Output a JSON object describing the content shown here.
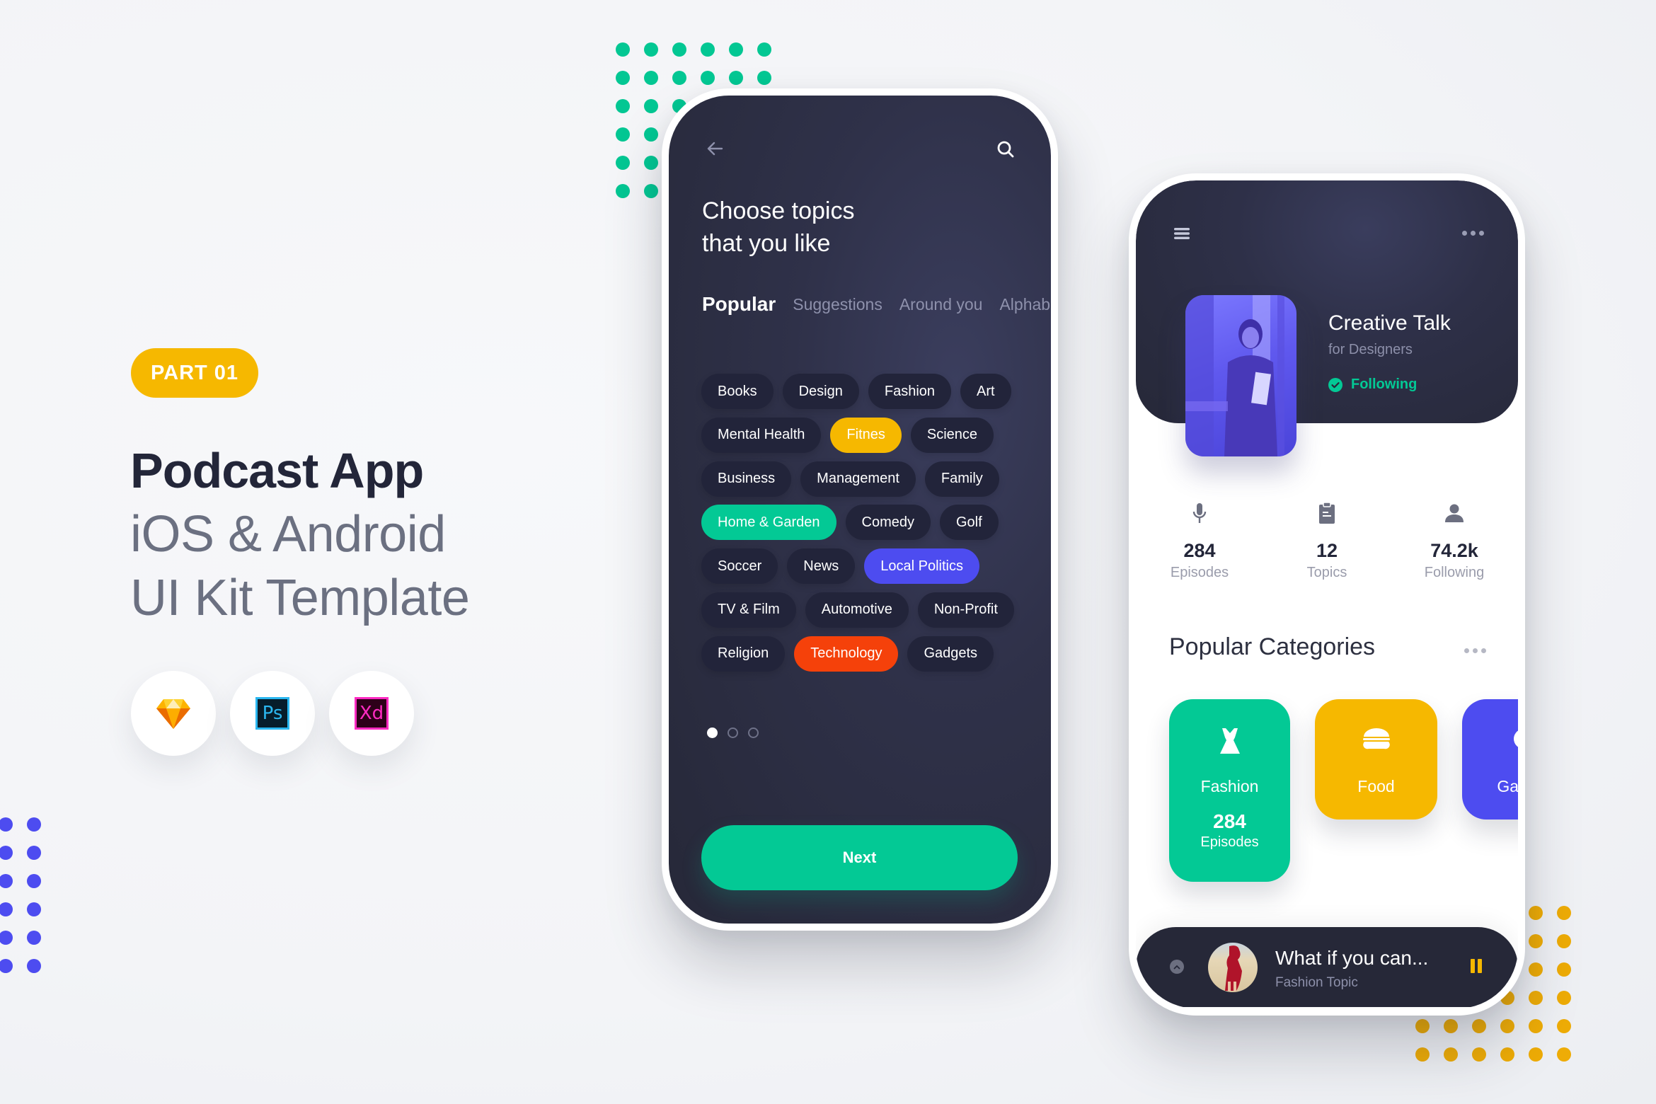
{
  "hero": {
    "badge": "PART 01",
    "title": "Podcast App",
    "subtitle_line1": "iOS & Android",
    "subtitle_line2": "UI Kit Template",
    "tools": [
      {
        "name": "Sketch",
        "icon": "sketch-icon"
      },
      {
        "name": "Ps",
        "icon": "photoshop-icon"
      },
      {
        "name": "Xd",
        "icon": "adobe-xd-icon"
      }
    ]
  },
  "colors": {
    "green": "#03c995",
    "yellow": "#f6b800",
    "purple": "#4d4cf0",
    "orange": "#f5410a",
    "dark": "#262838"
  },
  "topics_screen": {
    "title_line1": "Choose topics",
    "title_line2": "that you like",
    "tabs": [
      {
        "label": "Popular",
        "active": true
      },
      {
        "label": "Suggestions",
        "active": false
      },
      {
        "label": "Around you",
        "active": false
      },
      {
        "label": "Alphabetical",
        "active": false
      }
    ],
    "chip_rows": [
      [
        {
          "label": "Books"
        },
        {
          "label": "Design"
        },
        {
          "label": "Fashion"
        },
        {
          "label": "Art"
        }
      ],
      [
        {
          "label": "Mental Health"
        },
        {
          "label": "Fitnes",
          "selected": "yellow"
        },
        {
          "label": "Science"
        }
      ],
      [
        {
          "label": "Business"
        },
        {
          "label": "Management"
        },
        {
          "label": "Family"
        }
      ],
      [
        {
          "label": "Home & Garden",
          "selected": "green"
        },
        {
          "label": "Comedy"
        },
        {
          "label": "Golf"
        }
      ],
      [
        {
          "label": "Soccer"
        },
        {
          "label": "News"
        },
        {
          "label": "Local Politics",
          "selected": "purple"
        }
      ],
      [
        {
          "label": "TV & Film"
        },
        {
          "label": "Automotive"
        },
        {
          "label": "Non-Profit"
        }
      ],
      [
        {
          "label": "Religion"
        },
        {
          "label": "Technology",
          "selected": "orange"
        },
        {
          "label": "Gadgets"
        }
      ]
    ],
    "pager": {
      "current": 1,
      "total": 3
    },
    "next_label": "Next"
  },
  "profile_screen": {
    "show_title": "Creative Talk",
    "show_subtitle": "for Designers",
    "follow_status": "Following",
    "stats": [
      {
        "value": "284",
        "label": "Episodes",
        "icon": "microphone-icon"
      },
      {
        "value": "12",
        "label": "Topics",
        "icon": "clipboard-icon"
      },
      {
        "value": "74.2k",
        "label": "Following",
        "icon": "person-icon"
      }
    ],
    "section_title": "Popular Categories",
    "categories": [
      {
        "name": "Fashion",
        "count": "284",
        "unit": "Episodes",
        "color": "#03c995",
        "icon": "dress-icon"
      },
      {
        "name": "Food",
        "color": "#f6b800",
        "icon": "burger-icon"
      },
      {
        "name": "Games",
        "color": "#4d4cf0",
        "icon": "gamepad-icon"
      }
    ],
    "player": {
      "title": "What if you can...",
      "subtitle": "Fashion Topic",
      "state": "playing"
    }
  }
}
